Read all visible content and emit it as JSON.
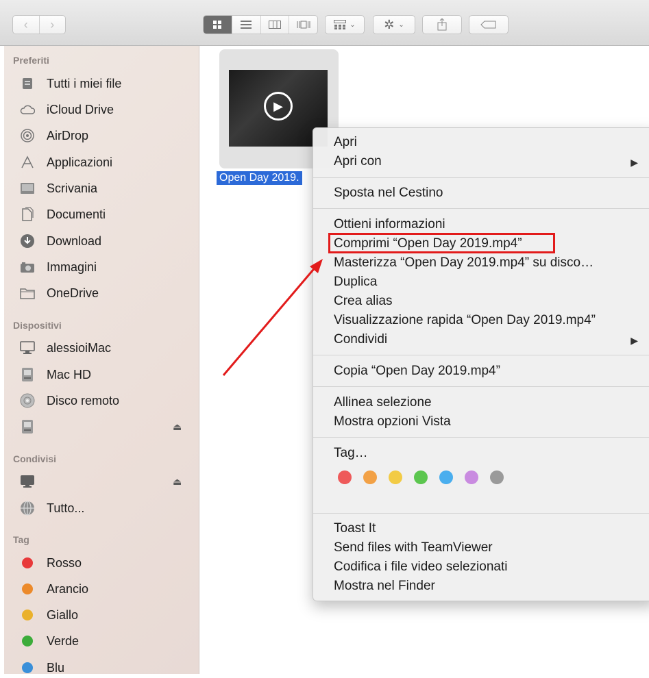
{
  "toolbar": {
    "back": "‹",
    "forward": "›",
    "views": [
      "icon-view",
      "list-view",
      "column-view",
      "coverflow-view"
    ],
    "arrange_icon": "arrange-icon",
    "action_icon": "gear-icon",
    "share_icon": "share-icon",
    "tag_icon": "tag-icon"
  },
  "sidebar": {
    "preferiti": {
      "title": "Preferiti",
      "items": [
        {
          "label": "Tutti i miei file",
          "icon": "all-files-icon"
        },
        {
          "label": "iCloud Drive",
          "icon": "cloud-icon"
        },
        {
          "label": "AirDrop",
          "icon": "airdrop-icon"
        },
        {
          "label": "Applicazioni",
          "icon": "applications-icon"
        },
        {
          "label": "Scrivania",
          "icon": "desktop-icon"
        },
        {
          "label": "Documenti",
          "icon": "documents-icon"
        },
        {
          "label": "Download",
          "icon": "download-icon"
        },
        {
          "label": "Immagini",
          "icon": "camera-icon"
        },
        {
          "label": "OneDrive",
          "icon": "folder-icon"
        }
      ]
    },
    "dispositivi": {
      "title": "Dispositivi",
      "items": [
        {
          "label": "alessioiMac",
          "icon": "imac-icon"
        },
        {
          "label": "Mac HD",
          "icon": "disk-icon"
        },
        {
          "label": "Disco remoto",
          "icon": "optical-disc-icon"
        },
        {
          "label": "",
          "icon": "disk-icon"
        }
      ]
    },
    "condivisi": {
      "title": "Condivisi",
      "items": [
        {
          "label": "",
          "icon": "monitor-icon"
        },
        {
          "label": "Tutto...",
          "icon": "network-globe-icon"
        }
      ]
    },
    "tag": {
      "title": "Tag",
      "items": [
        {
          "label": "Rosso",
          "color": "#e8393a"
        },
        {
          "label": "Arancio",
          "color": "#ec8a2b"
        },
        {
          "label": "Giallo",
          "color": "#eab12c"
        },
        {
          "label": "Verde",
          "color": "#3cac3a"
        },
        {
          "label": "Blu",
          "color": "#3a8fd9"
        }
      ]
    },
    "eject_symbol": "⏏"
  },
  "file": {
    "name": "Open Day 2019."
  },
  "menu": {
    "apri": "Apri",
    "apri_con": "Apri con",
    "sposta": "Sposta nel Cestino",
    "ottieni": "Ottieni informazioni",
    "comprimi": "Comprimi “Open Day 2019.mp4”",
    "masterizza": "Masterizza “Open Day 2019.mp4” su disco…",
    "duplica": "Duplica",
    "crea_alias": "Crea alias",
    "visualizzazione": "Visualizzazione rapida “Open Day 2019.mp4”",
    "condividi": "Condividi",
    "copia": "Copia “Open Day 2019.mp4”",
    "allinea": "Allinea selezione",
    "mostra_opzioni": "Mostra opzioni Vista",
    "tag": "Tag…",
    "tag_colors": [
      "#ee5a5a",
      "#f2a146",
      "#f2cb45",
      "#5cc64f",
      "#4aaeee",
      "#c98be0",
      "#9a9a9a"
    ],
    "toast": "Toast It",
    "teamviewer": "Send files with TeamViewer",
    "codifica": "Codifica i file video selezionati",
    "mostra_finder": "Mostra nel Finder",
    "submenu_arrow": "▶"
  },
  "annotation": {
    "highlight_color": "#e21b1b"
  }
}
